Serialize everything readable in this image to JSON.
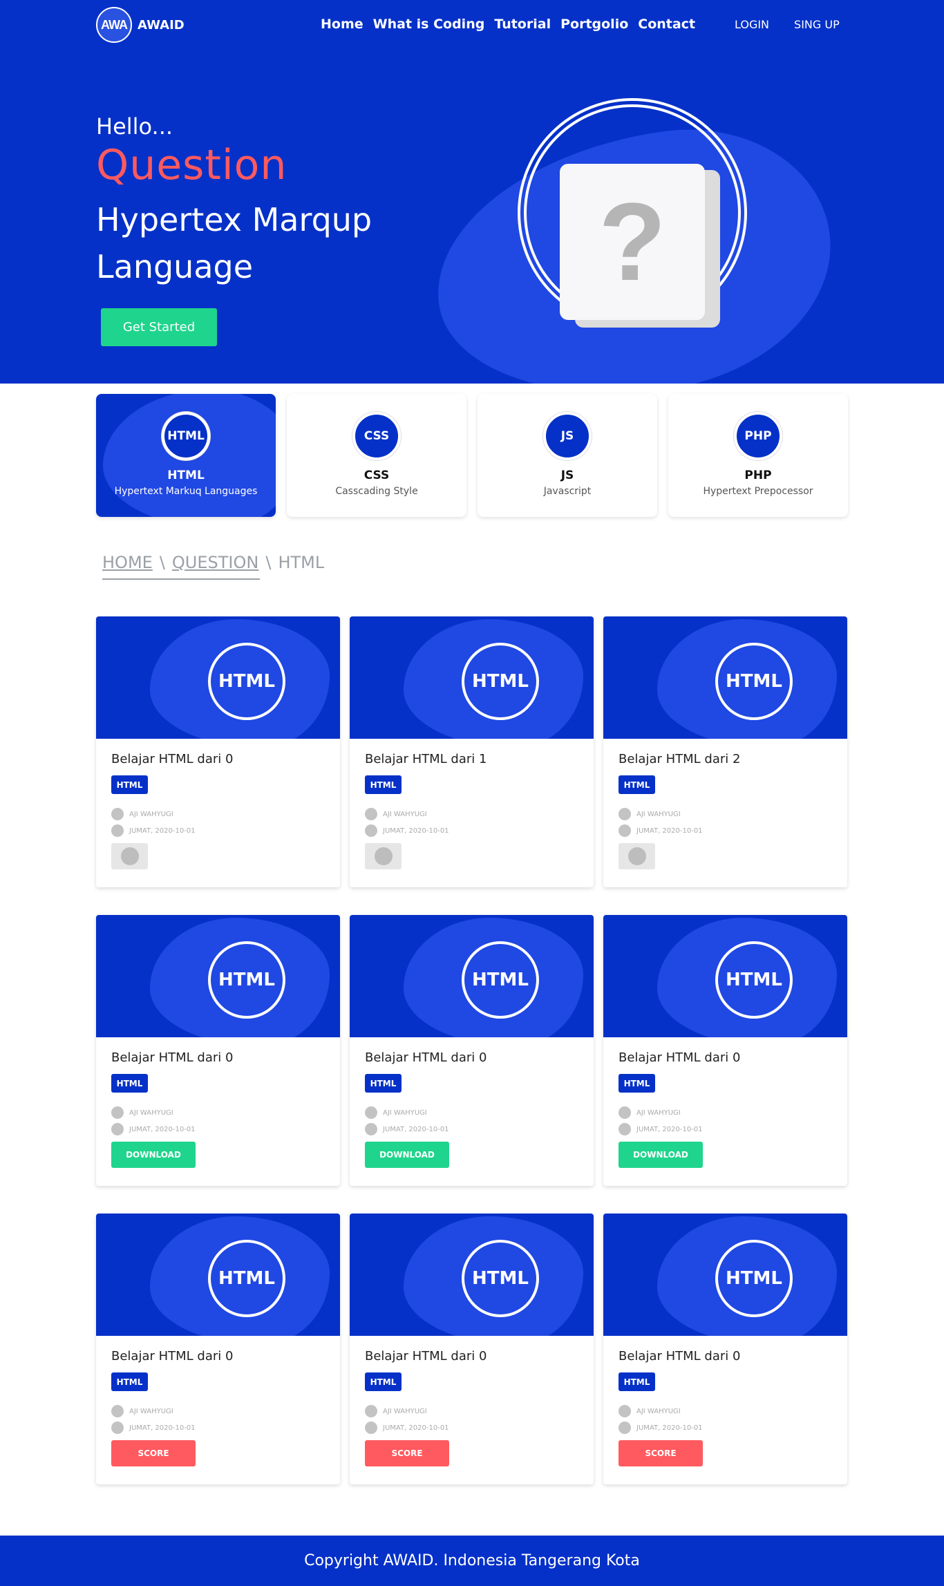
{
  "nav": {
    "logo_mark": "AWA",
    "brand": "AWAID",
    "menu": [
      "Home",
      "What is Coding",
      "Tutorial",
      "Portgolio",
      "Contact"
    ],
    "login": "LOGIN",
    "signup": "SING UP"
  },
  "hero": {
    "hello": "Hello...",
    "question": "Question",
    "title": "Hypertex Marqup Language",
    "cta": "Get Started",
    "illustration_symbol": "?"
  },
  "categories": [
    {
      "badge": "HTML",
      "name": "HTML",
      "desc": "Hypertext Markuq Languages",
      "active": true
    },
    {
      "badge": "CSS",
      "name": "CSS",
      "desc": "Casscading Style",
      "active": false
    },
    {
      "badge": "JS",
      "name": "JS",
      "desc": "Javascript",
      "active": false
    },
    {
      "badge": "PHP",
      "name": "PHP",
      "desc": "Hypertext Prepocessor",
      "active": false
    }
  ],
  "breadcrumb": {
    "home": "HOME",
    "sep1": "\\",
    "question": "QUESTION",
    "sep2": "\\",
    "current": "HTML"
  },
  "posts": [
    {
      "badge": "HTML",
      "title": "Belajar HTML dari 0",
      "tag": "HTML",
      "author": "AJI WAHYUGI",
      "date": "JUMAT, 2020-10-01",
      "action": ""
    },
    {
      "badge": "HTML",
      "title": "Belajar HTML dari 1",
      "tag": "HTML",
      "author": "AJI WAHYUGI",
      "date": "JUMAT, 2020-10-01",
      "action": ""
    },
    {
      "badge": "HTML",
      "title": "Belajar HTML dari 2",
      "tag": "HTML",
      "author": "AJI WAHYUGI",
      "date": "JUMAT, 2020-10-01",
      "action": ""
    },
    {
      "badge": "HTML",
      "title": "Belajar HTML dari 0",
      "tag": "HTML",
      "author": "AJI WAHYUGI",
      "date": "JUMAT, 2020-10-01",
      "action": "DOWNLOAD"
    },
    {
      "badge": "HTML",
      "title": "Belajar HTML dari 0",
      "tag": "HTML",
      "author": "AJI WAHYUGI",
      "date": "JUMAT, 2020-10-01",
      "action": "DOWNLOAD"
    },
    {
      "badge": "HTML",
      "title": "Belajar HTML dari 0",
      "tag": "HTML",
      "author": "AJI WAHYUGI",
      "date": "JUMAT, 2020-10-01",
      "action": "DOWNLOAD"
    },
    {
      "badge": "HTML",
      "title": "Belajar HTML dari 0",
      "tag": "HTML",
      "author": "AJI WAHYUGI",
      "date": "JUMAT, 2020-10-01",
      "action": "SCORE"
    },
    {
      "badge": "HTML",
      "title": "Belajar HTML dari 0",
      "tag": "HTML",
      "author": "AJI WAHYUGI",
      "date": "JUMAT, 2020-10-01",
      "action": "SCORE"
    },
    {
      "badge": "HTML",
      "title": "Belajar HTML dari 0",
      "tag": "HTML",
      "author": "AJI WAHYUGI",
      "date": "JUMAT, 2020-10-01",
      "action": "SCORE"
    }
  ],
  "footer": {
    "text": "Copyright AWAID. Indonesia Tangerang Kota"
  },
  "colors": {
    "primary": "#0631c8",
    "accent_blob": "#2048e3",
    "success": "#1fd48c",
    "danger": "#ff5a5f"
  }
}
